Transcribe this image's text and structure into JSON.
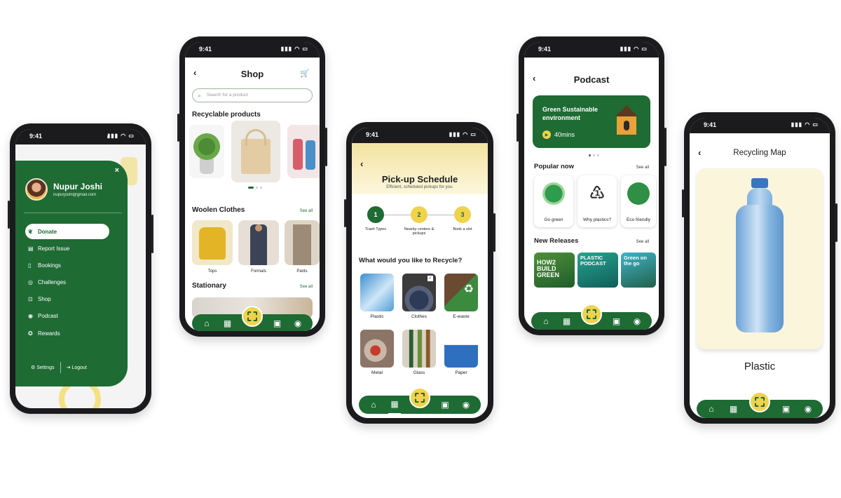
{
  "status_time": "9:41",
  "phone1": {
    "user_name": "Nupur Joshi",
    "user_email": "nupurjoshi@gmail.com",
    "close": "×",
    "menu": [
      {
        "label": "Donate",
        "icon": "donate-icon",
        "active": true
      },
      {
        "label": "Report Issue",
        "icon": "report-icon",
        "active": false
      },
      {
        "label": "Bookings",
        "icon": "bookings-icon",
        "active": false
      },
      {
        "label": "Challenges",
        "icon": "challenges-icon",
        "active": false
      },
      {
        "label": "Shop",
        "icon": "shop-icon",
        "active": false
      },
      {
        "label": "Podcast",
        "icon": "podcast-icon",
        "active": false
      },
      {
        "label": "Rewards",
        "icon": "rewards-icon",
        "active": false
      }
    ],
    "settings": "Settings",
    "logout": "Logout"
  },
  "phone2": {
    "title": "Shop",
    "search_placeholder": "Search for a product",
    "sections": {
      "recyclable": "Recyclable products",
      "woolen": "Woolen Clothes",
      "stationary": "Stationary"
    },
    "see_all": "See all",
    "woolen_items": [
      "Tops",
      "Formals",
      "Pants"
    ]
  },
  "phone3": {
    "title": "Pick-up Schedule",
    "subtitle": "Efficient, scheduled pickups for you.",
    "steps": [
      {
        "num": "1",
        "label": "Trash Types"
      },
      {
        "num": "2",
        "label": "Nearby centers & pickups"
      },
      {
        "num": "3",
        "label": "Book a slot"
      }
    ],
    "question": "What would you like to Recycle?",
    "types": [
      "Plastic",
      "Clothes",
      "E-waste",
      "Metal",
      "Glass",
      "Paper"
    ]
  },
  "phone4": {
    "title": "Podcast",
    "featured_title": "Green Sustainable environment",
    "featured_duration": "40mins",
    "popular": "Popular now",
    "see_all": "See all",
    "popular_items": [
      "Go green",
      "Why plastics?",
      "Eco friendly"
    ],
    "new_releases": "New Releases",
    "release_items": [
      "HOW2 BUILD GREEN",
      "PLASTIC PODCAST",
      "Green on the go"
    ]
  },
  "phone5": {
    "title": "Recycling Map",
    "material": "Plastic"
  },
  "colors": {
    "brand_green": "#1e6b34",
    "accent_yellow": "#f1d24b"
  }
}
